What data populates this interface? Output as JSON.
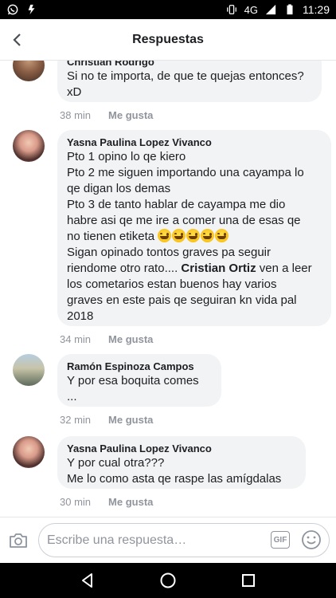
{
  "status_bar": {
    "network": "4G",
    "time": "11:29",
    "icons": [
      "whatsapp-icon",
      "flash-icon",
      "vibrate-icon",
      "signal-icon",
      "battery-icon"
    ]
  },
  "header": {
    "title": "Respuestas",
    "back_icon": "back-arrow-icon"
  },
  "comments": [
    {
      "author": "Christian Rodrigo",
      "lines": [
        "Si no te importa, de que te quejas entonces?",
        "xD"
      ],
      "time": "38 min",
      "like_label": "Me gusta"
    },
    {
      "author": "Yasna Paulina Lopez Vivanco",
      "lines": [
        "Pto 1 opino lo qe kiero",
        "Pto 2 me siguen importando una cayampa lo",
        "qe digan los demas",
        "Pto 3 de tanto hablar de cayampa me dio",
        "habre asi qe me ire a comer una de esas qe",
        "no tienen etiketa",
        "Sigan opinado tontos graves pa seguir",
        "riendome otro rato....",
        "Cristian Ortiz",
        "ven a leer",
        "los cometarios estan buenos hay varios",
        "graves en este pais qe seguiran kn vida pal",
        "2018"
      ],
      "emoji": "grinning-sweat-emoji",
      "time": "34 min",
      "like_label": "Me gusta"
    },
    {
      "author": "Ramón Espinoza Campos",
      "lines": [
        "Y por esa boquita comes",
        "..."
      ],
      "time": "32 min",
      "like_label": "Me gusta"
    },
    {
      "author": "Yasna Paulina Lopez Vivanco",
      "lines": [
        "Y por cual otra???",
        "Me lo como asta qe raspe las amígdalas"
      ],
      "time": "30 min",
      "like_label": "Me gusta"
    }
  ],
  "reply_bar": {
    "placeholder": "Escribe una respuesta…",
    "gif_label": "GIF",
    "camera_icon": "camera-icon",
    "emoji_icon": "smiley-icon"
  },
  "nav_bar": {
    "icons": [
      "back-triangle-icon",
      "home-circle-icon",
      "recents-square-icon"
    ]
  },
  "colors": {
    "bubble": "#f2f3f5",
    "meta_text": "#90949c",
    "text": "#1c1e21"
  }
}
